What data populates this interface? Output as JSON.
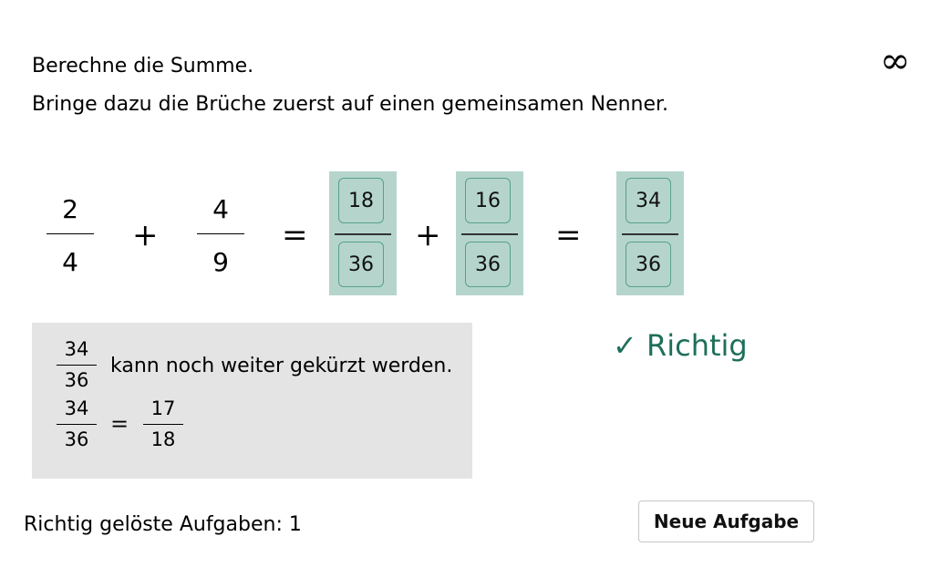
{
  "instructions": {
    "line1": "Berechne die Summe.",
    "line2": "Bringe dazu die Brüche zuerst auf einen gemeinsamen Nenner."
  },
  "symbols": {
    "infinity": "∞",
    "plus": "+",
    "equals": "="
  },
  "task": {
    "fraction1": {
      "numerator": "2",
      "denominator": "4"
    },
    "fraction2": {
      "numerator": "4",
      "denominator": "9"
    }
  },
  "answers": {
    "expanded1": {
      "numerator": "18",
      "denominator": "36"
    },
    "expanded2": {
      "numerator": "16",
      "denominator": "36"
    },
    "sum": {
      "numerator": "34",
      "denominator": "36"
    }
  },
  "hint": {
    "fraction": {
      "numerator": "34",
      "denominator": "36"
    },
    "text": "kann noch weiter gekürzt werden.",
    "simplified": {
      "numerator": "17",
      "denominator": "18"
    }
  },
  "feedback": {
    "text": "✓ Richtig",
    "color": "#1d6f5a"
  },
  "status": {
    "solved_label": "Richtig gelöste Aufgaben: 1"
  },
  "actions": {
    "new_task_label": "Neue Aufgabe"
  },
  "colors": {
    "answer_box": "#b5d5cc",
    "field_border": "#58a08c",
    "hint_background": "#e4e4e4"
  }
}
